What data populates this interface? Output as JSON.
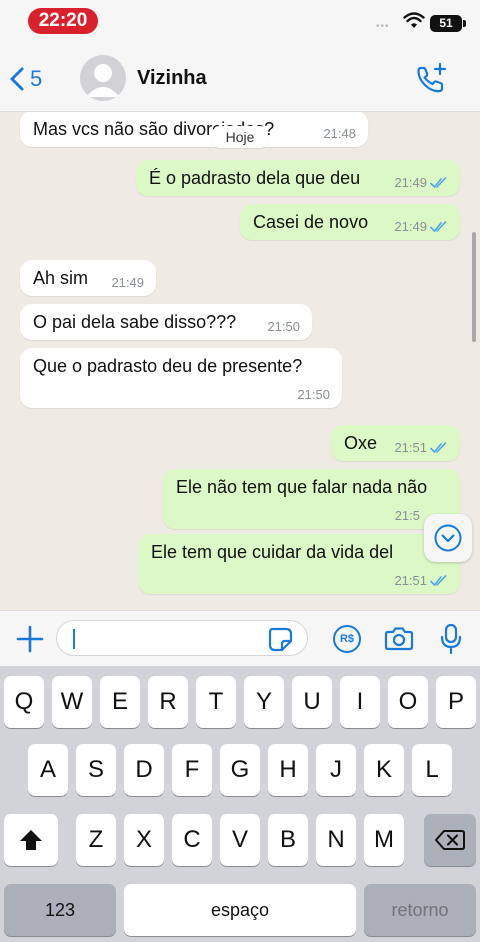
{
  "status_bar": {
    "time": "22:20",
    "battery": "51"
  },
  "header": {
    "back_count": "5",
    "contact_name": "Vizinha"
  },
  "chat": {
    "date_label": "Hoje",
    "messages": [
      {
        "dir": "in",
        "text": "Mas vcs não são divorciados?",
        "time": "21:48"
      },
      {
        "dir": "out",
        "text": "É o padrasto dela que deu",
        "time": "21:49"
      },
      {
        "dir": "out",
        "text": "Casei de novo",
        "time": "21:49"
      },
      {
        "dir": "in",
        "text": "Ah sim",
        "time": "21:49"
      },
      {
        "dir": "in",
        "text": "O pai dela sabe disso???",
        "time": "21:50"
      },
      {
        "dir": "in",
        "text": "Que o padrasto deu de presente?",
        "time": "21:50"
      },
      {
        "dir": "out",
        "text": "Oxe",
        "time": "21:51"
      },
      {
        "dir": "out",
        "text": "Ele não tem que falar nada não",
        "time": "21:5"
      },
      {
        "dir": "out",
        "text": "Ele tem que cuidar da vida del",
        "time": "21:51"
      }
    ]
  },
  "input_bar": {
    "icons": [
      "plus-icon",
      "sticker-icon",
      "pix-payment-icon",
      "camera-icon",
      "microphone-icon"
    ],
    "pix_label": "R$"
  },
  "keyboard": {
    "row1": [
      "Q",
      "W",
      "E",
      "R",
      "T",
      "Y",
      "U",
      "I",
      "O",
      "P"
    ],
    "row2": [
      "A",
      "S",
      "D",
      "F",
      "G",
      "H",
      "J",
      "K",
      "L"
    ],
    "row3": [
      "Z",
      "X",
      "C",
      "V",
      "B",
      "N",
      "M"
    ],
    "numbers_key": "123",
    "space_key": "espaço",
    "return_key": "retorno"
  },
  "colors": {
    "accent": "#1a7ad9",
    "outgoing_bubble": "#dcf8c6",
    "incoming_bubble": "#ffffff",
    "chat_background": "#efeae4",
    "time_pill": "#d9212e",
    "read_ticks": "#4fa6e8"
  }
}
